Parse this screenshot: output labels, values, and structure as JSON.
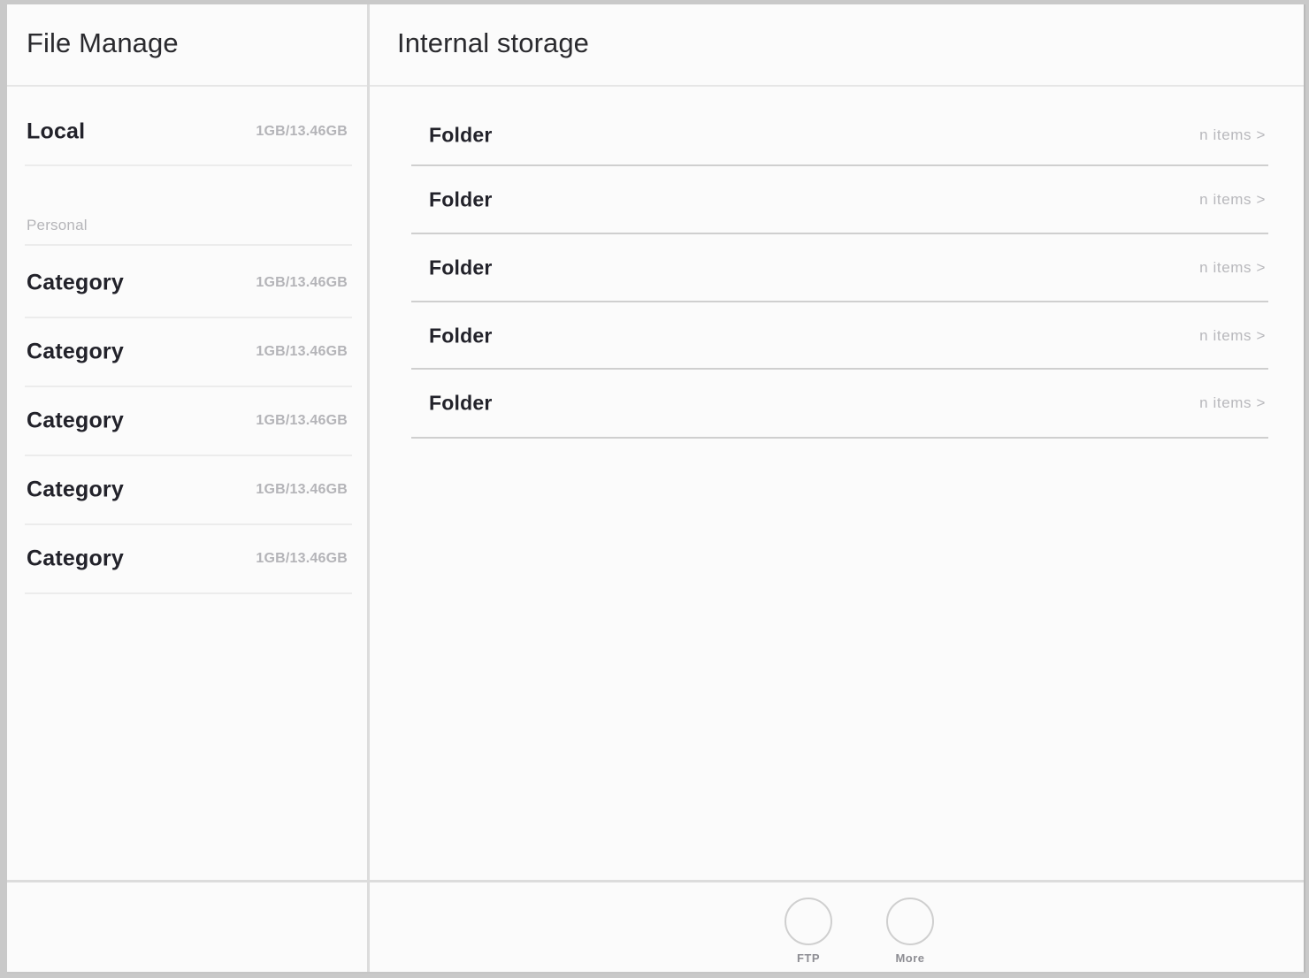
{
  "window": {
    "left_panel_title": "File Manage",
    "right_panel_title": "Internal storage"
  },
  "sidebar": {
    "storage": {
      "label": "Local",
      "value": "1GB/13.46GB"
    },
    "section_label": "Personal",
    "categories": [
      {
        "label": "Category",
        "value": "1GB/13.46GB"
      },
      {
        "label": "Category",
        "value": "1GB/13.46GB"
      },
      {
        "label": "Category",
        "value": "1GB/13.46GB"
      },
      {
        "label": "Category",
        "value": "1GB/13.46GB"
      },
      {
        "label": "Category",
        "value": "1GB/13.46GB"
      }
    ]
  },
  "filelist": {
    "rows": [
      {
        "name": "Folder",
        "meta": "n items >"
      },
      {
        "name": "Folder",
        "meta": "n items >"
      },
      {
        "name": "Folder",
        "meta": "n items >"
      },
      {
        "name": "Folder",
        "meta": "n items >"
      },
      {
        "name": "Folder",
        "meta": "n items >"
      }
    ]
  },
  "bottombar": {
    "buttons": [
      {
        "label": "FTP",
        "icon": "circle-icon"
      },
      {
        "label": "More",
        "icon": "circle-icon"
      }
    ]
  },
  "colors": {
    "page_background": "#fbfbfb",
    "outer_frame": "#c9c9c9",
    "text_primary": "#22222a",
    "text_muted": "#b5b5b9",
    "divider": "#dcdcdc",
    "row_rule_light": "#ececec",
    "row_rule_dark": "#cfcfcf"
  }
}
